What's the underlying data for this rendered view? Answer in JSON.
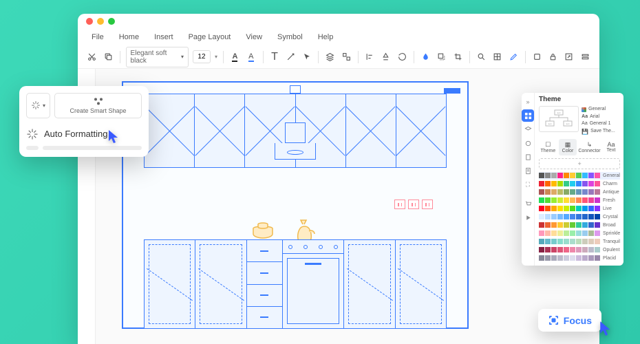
{
  "menu": {
    "items": [
      "File",
      "Home",
      "Insert",
      "Page Layout",
      "View",
      "Symbol",
      "Help"
    ]
  },
  "toolbar": {
    "font": "Elegant soft black",
    "size": "12"
  },
  "popup": {
    "create_smart_shape": "Create Smart Shape",
    "auto_formatting": "Auto Formatting"
  },
  "theme": {
    "title": "Theme",
    "panel_items": [
      "General",
      "Arial",
      "General 1",
      "Save The..."
    ],
    "tabs": [
      "Theme",
      "Color",
      "Connector",
      "Text"
    ],
    "active_tab": 1,
    "palettes": [
      {
        "name": "General",
        "colors": [
          "#555",
          "#888",
          "#aaa",
          "#f28",
          "#f80",
          "#fc3",
          "#5c5",
          "#3bf",
          "#85f",
          "#f5a"
        ]
      },
      {
        "name": "Charm",
        "colors": [
          "#e23",
          "#f60",
          "#fb0",
          "#ad0",
          "#3c8",
          "#2ce",
          "#38f",
          "#85e",
          "#d4d",
          "#f59"
        ]
      },
      {
        "name": "Antique",
        "colors": [
          "#a55",
          "#c85",
          "#da6",
          "#bb6",
          "#8a6",
          "#6a8",
          "#69b",
          "#78c",
          "#97b",
          "#b79"
        ]
      },
      {
        "name": "Fresh",
        "colors": [
          "#2d5",
          "#5d3",
          "#9e3",
          "#ce3",
          "#fd3",
          "#fb5",
          "#f85",
          "#f57",
          "#e49",
          "#c3c"
        ]
      },
      {
        "name": "Live",
        "colors": [
          "#f02",
          "#f50",
          "#fa0",
          "#fd0",
          "#ce0",
          "#5d2",
          "#0cb",
          "#09e",
          "#36f",
          "#83f"
        ]
      },
      {
        "name": "Crystal",
        "colors": [
          "#def",
          "#bdf",
          "#9cf",
          "#7bf",
          "#5af",
          "#48e",
          "#37d",
          "#26c",
          "#15b",
          "#04a"
        ]
      },
      {
        "name": "Broad",
        "colors": [
          "#c33",
          "#e63",
          "#f93",
          "#fc3",
          "#cc3",
          "#6c3",
          "#3c9",
          "#3ad",
          "#36c",
          "#63c"
        ]
      },
      {
        "name": "Sprinkle",
        "colors": [
          "#f9b",
          "#fba",
          "#fd9",
          "#ee9",
          "#be9",
          "#9ea",
          "#9dd",
          "#9ce",
          "#ab9f",
          "#d9e"
        ]
      },
      {
        "name": "Tranquil",
        "colors": [
          "#5ab",
          "#6bc",
          "#7cc",
          "#8dc",
          "#9dc",
          "#adc",
          "#bdb",
          "#ccb",
          "#dcb",
          "#ecb"
        ]
      },
      {
        "name": "Opulent",
        "colors": [
          "#824",
          "#a35",
          "#c46",
          "#d57",
          "#e68",
          "#e8a",
          "#d9b",
          "#cab",
          "#bbc",
          "#acc"
        ]
      },
      {
        "name": "Placid",
        "colors": [
          "#889",
          "#99a",
          "#aab",
          "#bbc",
          "#ccd",
          "#dde",
          "#cbd",
          "#bac",
          "#a9b",
          "#98a"
        ]
      }
    ],
    "selected_palette": 0
  },
  "focus": {
    "label": "Focus"
  }
}
